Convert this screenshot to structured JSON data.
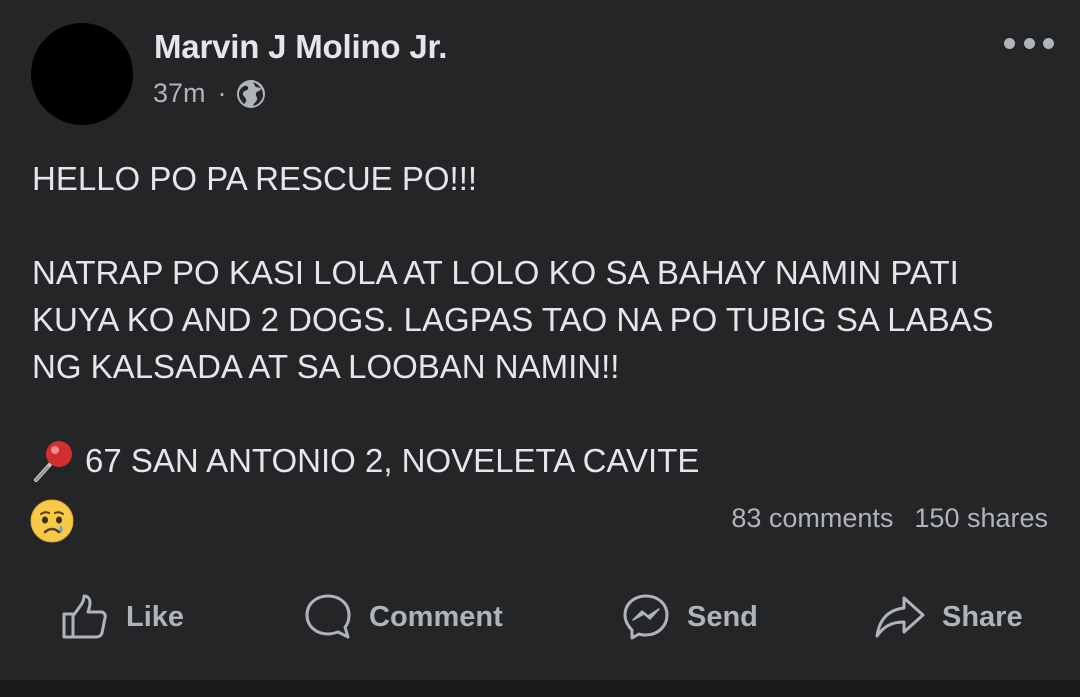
{
  "post": {
    "author": "Marvin J Molino Jr.",
    "time": "37m",
    "separator": "·",
    "privacy_icon": "globe-icon",
    "more_icon": "more-options-icon",
    "body": {
      "line1": "HELLO PO PA RESCUE PO!!!",
      "para2": [
        "NATRAP PO KASI LOLA AT LOLO KO SA BAHAY NAMIN PATI",
        "KUYA KO AND 2 DOGS. LAGPAS TAO NA PO TUBIG SA LABAS",
        "NG KALSADA AT SA LOOBAN NAMIN!!"
      ],
      "location_icon": "round-pushpin-icon",
      "location": "67 SAN ANTONIO 2, NOVELETA CAVITE"
    },
    "reaction_icon": "sad-reaction-icon",
    "comments": "83 comments",
    "shares": "150 shares"
  },
  "actions": {
    "like": "Like",
    "comment": "Comment",
    "send": "Send",
    "share": "Share"
  },
  "colors": {
    "background": "#242526",
    "primary_text": "#e4e6eb",
    "secondary_text": "#b0b3b8"
  }
}
